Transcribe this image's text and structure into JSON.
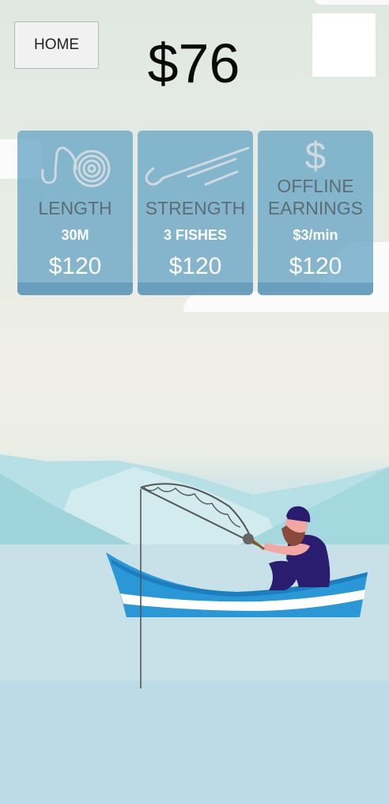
{
  "header": {
    "home_label": "HOME",
    "money": "$76"
  },
  "upgrades": [
    {
      "title": "LENGTH",
      "value": "30M",
      "price": "$120",
      "icon": "coiled-line-icon"
    },
    {
      "title": "STRENGTH",
      "value": "3 FISHES",
      "price": "$120",
      "icon": "fishing-hook-icon"
    },
    {
      "title_line1": "OFFLINE",
      "title_line2": "EARNINGS",
      "value": "$3/min",
      "price": "$120",
      "icon": "dollar-icon"
    }
  ],
  "colors": {
    "card": "#5da0c2",
    "card_title": "#5d6d73",
    "boat": "#2a97d6",
    "fisherman_clothes": "#2a1c6e",
    "water": "#c9e2e8"
  }
}
